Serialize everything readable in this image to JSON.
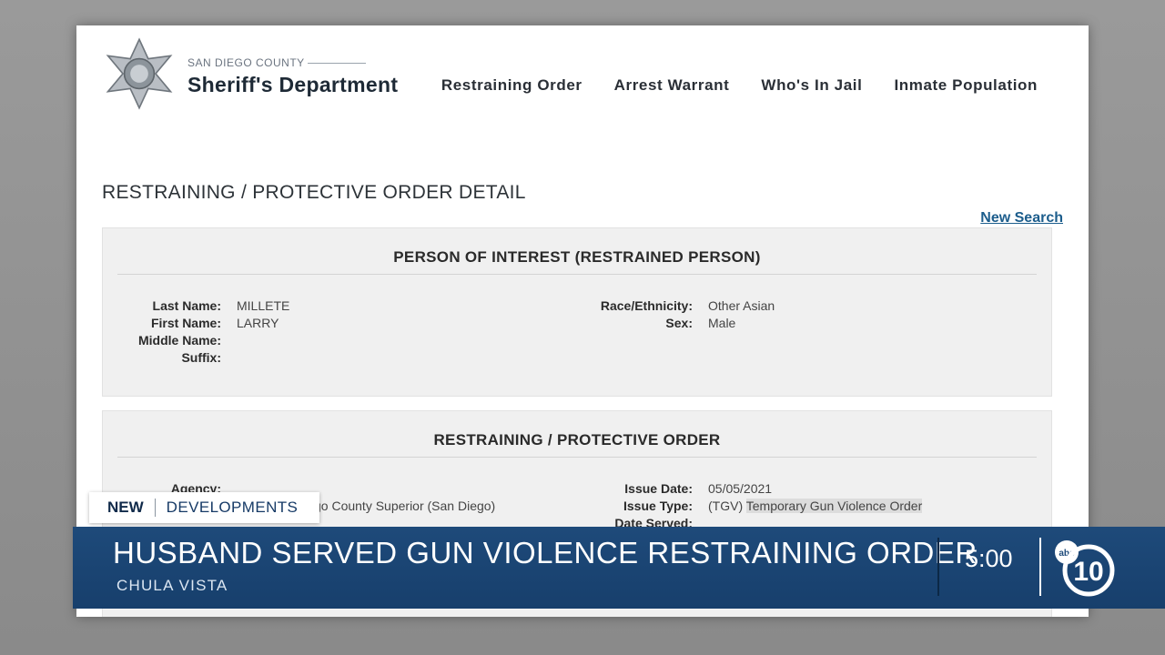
{
  "brand": {
    "county": "SAN DIEGO COUNTY",
    "department": "Sheriff's Department"
  },
  "nav": [
    "Restraining Order",
    "Arrest Warrant",
    "Who's In Jail",
    "Inmate Population"
  ],
  "page_title": "RESTRAINING / PROTECTIVE ORDER DETAIL",
  "new_search": "New Search",
  "person_panel": {
    "heading": "PERSON OF INTEREST (RESTRAINED PERSON)",
    "left": [
      {
        "label": "Last Name:",
        "value": "MILLETE"
      },
      {
        "label": "First Name:",
        "value": "LARRY"
      },
      {
        "label": "Middle Name:",
        "value": ""
      },
      {
        "label": "Suffix:",
        "value": ""
      }
    ],
    "right": [
      {
        "label": "Race/Ethnicity:",
        "value": "Other Asian"
      },
      {
        "label": "Sex:",
        "value": "Male"
      }
    ]
  },
  "order_panel": {
    "heading": "RESTRAINING / PROTECTIVE ORDER",
    "left": [
      {
        "label": "Agency:",
        "value": ""
      },
      {
        "label": "",
        "value": "go County Superior (San Diego)"
      }
    ],
    "right": [
      {
        "label": "Issue Date:",
        "value": "05/05/2021"
      },
      {
        "label": "Issue Type:",
        "value": "(TGV)",
        "highlight": "Temporary Gun Violence Order"
      },
      {
        "label": "Date Served:",
        "value": ""
      }
    ]
  },
  "chyron": {
    "tag_new": "NEW",
    "tag_dev": "DEVELOPMENTS",
    "headline": "HUSBAND SERVED GUN VIOLENCE RESTRAINING ORDER",
    "subline": "CHULA VISTA",
    "time": "5:00",
    "station_logo": "abc 10"
  },
  "colors": {
    "chyron_blue": "#1e4a7a",
    "link_blue": "#1c5d8c"
  }
}
